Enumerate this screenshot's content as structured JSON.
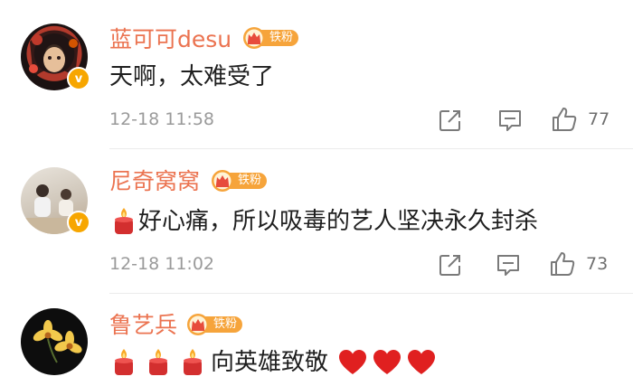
{
  "comments": [
    {
      "username": "蓝可可desu",
      "fan_badge": "铁粉",
      "text": "天啊，太难受了",
      "time": "12-18 11:58",
      "likes": "77",
      "verified_mark": "v",
      "avatar_icon": "anime-girl-avatar"
    },
    {
      "username": "尼奇窝窝",
      "fan_badge": "铁粉",
      "text": "好心痛，所以吸毒的艺人坚决永久封杀",
      "time": "12-18 11:02",
      "likes": "73",
      "verified_mark": "v",
      "avatar_icon": "child-photo-avatar",
      "emoji_prefix": "candle-icon"
    },
    {
      "username": "鲁艺兵",
      "fan_badge": "铁粉",
      "text": "向英雄致敬",
      "avatar_icon": "orchid-flower-avatar",
      "emoji_prefix": "candle-icon",
      "emoji_suffix": "heart-icon"
    }
  ],
  "colors": {
    "username": "#eb7350",
    "badge": "#f6a43b",
    "verified": "#f7a600",
    "meta": "#9a9a9a"
  }
}
